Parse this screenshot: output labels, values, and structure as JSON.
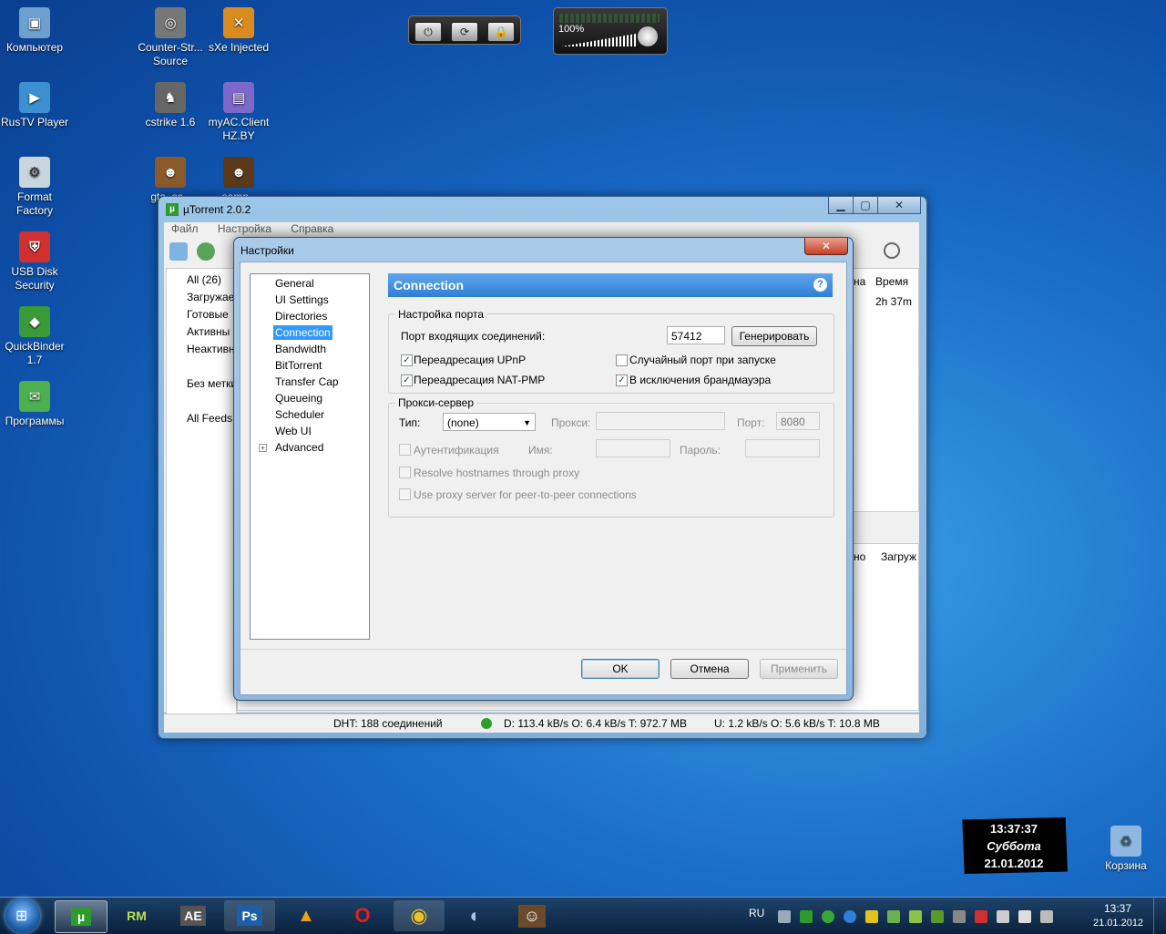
{
  "desktop_icons": [
    {
      "label": "Компьютер",
      "icon": "computer-icon",
      "color": "#6f9fcf"
    },
    {
      "label": "RusTV Player",
      "icon": "tv-icon",
      "color": "#3c8fd0"
    },
    {
      "label": "Format Factory",
      "icon": "format-factory-icon",
      "color": "#c9d6e0"
    },
    {
      "label": "USB Disk Security",
      "icon": "shield-icon",
      "color": "#d03030"
    },
    {
      "label": "QuickBinder 1.7",
      "icon": "quickbinder-icon",
      "color": "#3a9a3a"
    },
    {
      "label": "Программы",
      "icon": "folder-icon",
      "color": "#4caf50"
    },
    {
      "label": "Counter-Strike Source",
      "label_display": "Counter-Str... Source",
      "icon": "cs-source-icon",
      "color": "#777"
    },
    {
      "label": "sXe Injected",
      "icon": "sxe-icon",
      "color": "#d98b1e"
    },
    {
      "label": "cstrike 1.6",
      "icon": "cstrike-icon",
      "color": "#666"
    },
    {
      "label": "myAC.Client HZ.BY",
      "icon": "myac-icon",
      "color": "#7b68c8"
    },
    {
      "label": "gta_sa",
      "label_display": "gta_sa -",
      "icon": "gta-icon",
      "color": "#8a5a2a"
    },
    {
      "label": "samp",
      "label_display": "samp -",
      "icon": "samp-icon",
      "color": "#5a3a1a"
    }
  ],
  "gadgets": {
    "volume_label": "100%"
  },
  "clock_gadget": {
    "time": "13:37:37",
    "day": "Суббота",
    "date": "21.01.2012"
  },
  "utorrent": {
    "title": "µTorrent 2.0.2",
    "menu": [
      "Файл",
      "Настройка",
      "Справка"
    ],
    "sidebar": [
      "All (26)",
      "Загружае",
      "Готовые",
      "Активны",
      "Неактивн",
      "Без метки",
      "All Feeds"
    ],
    "column_right": "Время",
    "column_value": "2h 37m",
    "column_peek": "на",
    "lower_col": "Загруж",
    "lower_col_peek": "но",
    "status": {
      "dht": "DHT: 188 соединений",
      "down": "D: 113.4 kB/s O: 6.4 kB/s T: 972.7 MB",
      "up": "U: 1.2 kB/s O: 5.6 kB/s T: 10.8 MB"
    }
  },
  "dialog": {
    "title": "Настройки",
    "tree": [
      "General",
      "UI Settings",
      "Directories",
      "Connection",
      "Bandwidth",
      "BitTorrent",
      "Transfer Cap",
      "Queueing",
      "Scheduler",
      "Web UI",
      "Advanced"
    ],
    "selected": "Connection",
    "panel_title": "Connection",
    "port_group": {
      "title": "Настройка порта",
      "port_label": "Порт входящих соединений:",
      "port_value": "57412",
      "generate_btn": "Генерировать",
      "upnp": "Переадресация UPnP",
      "natpmp": "Переадресация NAT-PMP",
      "random_port": "Случайный порт при запуске",
      "firewall": "В исключения брандмауэра"
    },
    "proxy_group": {
      "title": "Прокси-сервер",
      "type_label": "Тип:",
      "type_value": "(none)",
      "proxy_label": "Прокси:",
      "port_label": "Порт:",
      "port_value": "8080",
      "auth": "Аутентификация",
      "name_label": "Имя:",
      "password_label": "Пароль:",
      "resolve": "Resolve hostnames through proxy",
      "p2p": "Use proxy server for peer-to-peer connections"
    },
    "buttons": {
      "ok": "OK",
      "cancel": "Отмена",
      "apply": "Применить"
    }
  },
  "taskbar": {
    "items": [
      {
        "name": "utorrent",
        "glyph": "µ",
        "color": "#2e9a2e"
      },
      {
        "name": "rm",
        "glyph": "RM",
        "color": "#9ac33c"
      },
      {
        "name": "after-effects",
        "glyph": "AE",
        "color": "#555"
      },
      {
        "name": "photoshop",
        "glyph": "Ps",
        "color": "#1f5fa8"
      },
      {
        "name": "aimp",
        "glyph": "▲",
        "color": "#e5a21b"
      },
      {
        "name": "opera",
        "glyph": "O",
        "color": "#d31a1a"
      },
      {
        "name": "chrome",
        "glyph": "◉",
        "color": "#3b8f3b"
      },
      {
        "name": "teamspeak",
        "glyph": "◐",
        "color": "#6a8ab0"
      },
      {
        "name": "samp-task",
        "glyph": "☺",
        "color": "#6a4a2a"
      }
    ],
    "lang": "RU",
    "time": "13:37",
    "date": "21.01.2012",
    "recycle_bin": "Корзина"
  }
}
